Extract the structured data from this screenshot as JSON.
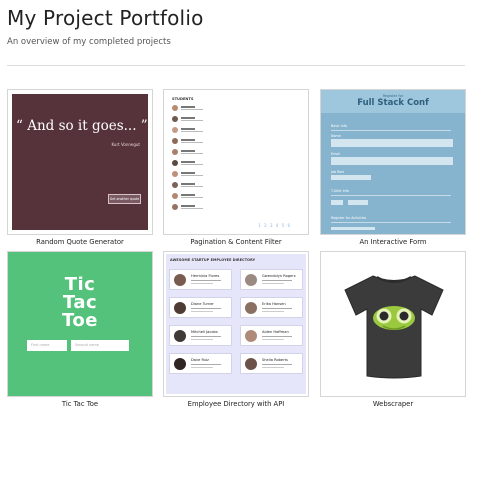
{
  "header": {
    "title": "My Project Portfolio",
    "subtitle": "An overview of my completed projects"
  },
  "projects": [
    {
      "caption": "Random Quote Generator",
      "preview": {
        "quote": "“ And so it goes... ”",
        "author": "Kurt Vonnegut",
        "button": "Get another quote"
      }
    },
    {
      "caption": "Pagination & Content Filter",
      "preview": {
        "heading": "STUDENTS",
        "pager": "1 2 3 4 5 6"
      }
    },
    {
      "caption": "An Interactive Form",
      "preview": {
        "kicker": "Register for",
        "title": "Full Stack Conf",
        "section_basic": "Basic Info",
        "label_name": "Name",
        "label_email": "Email",
        "label_job": "Job Role",
        "section_tshirt": "T-Shirt Info",
        "section_activities": "Register for Activities"
      }
    },
    {
      "caption": "Tic Tac Toe",
      "preview": {
        "title_line1": "Tic",
        "title_line2": "Tac",
        "title_line3": "Toe",
        "input1": "First name",
        "input2": "Second name"
      }
    },
    {
      "caption": "Employee Directory with API",
      "preview": {
        "heading": "AWESOME STARTUP EMPLOYEE DIRECTORY",
        "employees": [
          "Herminia Flores",
          "Gwendolyn Rogers",
          "Diane Turner",
          "Erika Hansen",
          "Mitchell Jacobs",
          "Aiden Hoffman",
          "Dave Ruiz",
          "Sheila Roberts"
        ]
      }
    },
    {
      "caption": "Webscraper",
      "preview": {}
    }
  ],
  "colors": {
    "quote_bg": "#56323a",
    "conf_bg": "#86b3cd",
    "ttt_bg": "#54c27b",
    "emp_bg": "#e6e6fa",
    "shirt": "#3a3a3a"
  }
}
